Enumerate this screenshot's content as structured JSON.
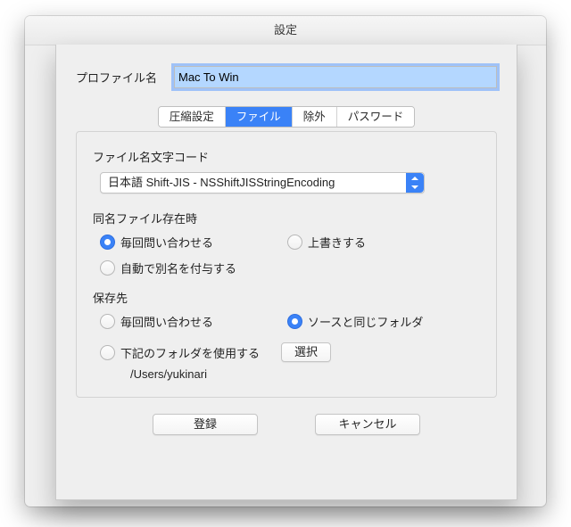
{
  "window": {
    "title": "設定"
  },
  "profile": {
    "label": "プロファイル名",
    "value": "Mac To Win"
  },
  "tabs": {
    "compress": "圧縮設定",
    "file": "ファイル",
    "exclude": "除外",
    "password": "パスワード"
  },
  "file_pane": {
    "encoding_label": "ファイル名文字コード",
    "encoding_value": "日本語 Shift-JIS - NSShiftJISStringEncoding",
    "exist_label": "同名ファイル存在時",
    "exist_options": {
      "ask": "毎回問い合わせる",
      "overwrite": "上書きする",
      "auto_alias": "自動で別名を付与する"
    },
    "dest_label": "保存先",
    "dest_options": {
      "ask": "毎回問い合わせる",
      "same": "ソースと同じフォルダ",
      "use_below": "下記のフォルダを使用する"
    },
    "dest_choose_button": "選択",
    "dest_path": "/Users/yukinari"
  },
  "buttons": {
    "register": "登録",
    "cancel": "キャンセル"
  }
}
